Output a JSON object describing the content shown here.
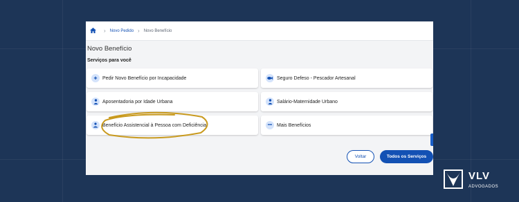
{
  "breadcrumb": {
    "home_icon": "home-icon",
    "items": [
      "Novo Pedido",
      "Novo Benefício"
    ]
  },
  "page": {
    "title": "Novo Benefício",
    "subtitle": "Serviços para você"
  },
  "services": [
    {
      "label": "Pedir Novo Benefício por Incapacidade",
      "icon": "medical-kit-icon"
    },
    {
      "label": "Seguro Defeso - Pescador Artesanal",
      "icon": "fish-icon"
    },
    {
      "label": "Aposentadoria por Idade Urbana",
      "icon": "person-icon"
    },
    {
      "label": "Salário-Maternidade Urbano",
      "icon": "person-icon"
    },
    {
      "label": "Benefício Assistencial à Pessoa com Deficiência",
      "icon": "person-hand-icon"
    },
    {
      "label": "Mais Benefícios",
      "icon": "more-icon"
    }
  ],
  "actions": {
    "back": "Voltar",
    "all_services": "Todos os Serviços"
  },
  "logo": {
    "brand": "VLV",
    "subtitle": "ADVOGADOS"
  },
  "colors": {
    "background": "#1d3557",
    "accent": "#1351b4",
    "highlight_ellipse": "#c99a1e"
  }
}
